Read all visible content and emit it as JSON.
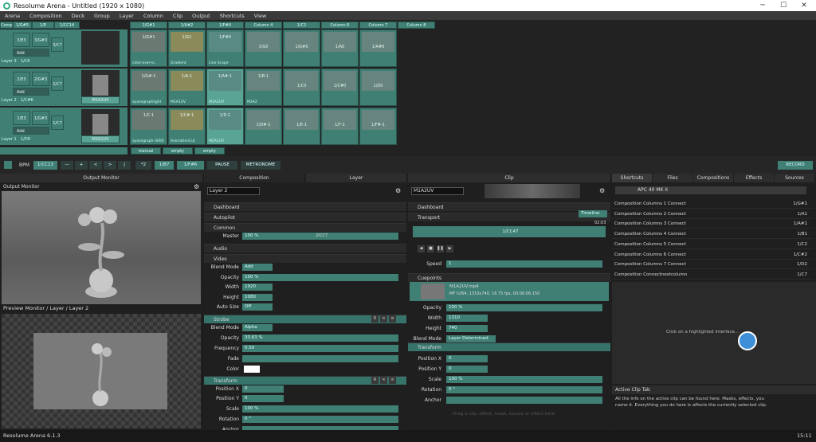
{
  "title": "Resolume Arena - Untitled (1920 x 1080)",
  "menu": [
    "Arena",
    "Composition",
    "Deck",
    "Group",
    "Layer",
    "Column",
    "Clip",
    "Output",
    "Shortcuts",
    "View"
  ],
  "deck": {
    "col_headers": [
      "1/G#1",
      "1/A#2",
      "1/F#0",
      "Column 4",
      "1/C2",
      "Column 6",
      "Column 7",
      "Column 8"
    ],
    "top_tabs": [
      "Comp",
      "1/G#5",
      "1/E",
      "1/CC14"
    ],
    "layers": [
      {
        "name": "Layer 3",
        "key": "1/C6",
        "btns": [
          "3/E3",
          "3/G#3",
          "3/C7"
        ],
        "sub": "Add",
        "clips": [
          {
            "label": "color-over-vi..",
            "key": "1/G#1"
          },
          {
            "label": "Gradient",
            "key": "1/G1"
          },
          {
            "label": "Line Scape",
            "key": "1/F#0"
          },
          {
            "label": "",
            "key": "1/G0"
          },
          {
            "label": "",
            "key": "1/G#0"
          },
          {
            "label": "",
            "key": "1/A0"
          },
          {
            "label": "",
            "key": "1/A#0"
          }
        ],
        "aside": ""
      },
      {
        "name": "Layer 2",
        "key": "1/C#6",
        "btns": [
          "2/E3",
          "2/G#3",
          "2/C7"
        ],
        "sub": "Add",
        "clips": [
          {
            "label": "spacegraphlight",
            "key": "1/G#-1"
          },
          {
            "label": "M1A1UV",
            "key": "1/A-1"
          },
          {
            "label": "M1A2UV",
            "key": "1/A#-1"
          },
          {
            "label": "M3A2",
            "key": "1/B-1"
          },
          {
            "label": "",
            "key": "1/C0"
          },
          {
            "label": "",
            "key": "1/C#0"
          },
          {
            "label": "",
            "key": "1/D0"
          }
        ],
        "aside": "M1A2UV"
      },
      {
        "name": "Layer 1",
        "key": "1/D6",
        "btns": [
          "1/E3",
          "1/G#3",
          "1/C7"
        ],
        "sub": "Add",
        "clips": [
          {
            "label": "spacegraph-3000",
            "key": "1/C-1"
          },
          {
            "label": "AnimationCut",
            "key": "1/C#-1"
          },
          {
            "label": "M2A1UV",
            "key": "1/D-1"
          },
          {
            "label": "",
            "key": "1/D#-1"
          },
          {
            "label": "",
            "key": "1/E-1"
          },
          {
            "label": "",
            "key": "1/F-1"
          },
          {
            "label": "",
            "key": "1/F#-1"
          }
        ],
        "aside": "M2A1UV"
      }
    ],
    "deck_tabs": [
      "manual",
      "empty",
      "empty"
    ]
  },
  "transport": {
    "bpm_label": "BPM",
    "bpm": "1/CC13",
    "keys": [
      "1/B7",
      "1/F#6"
    ],
    "pause": "PAUSE",
    "metronome": "METRONOME",
    "record": "RECORD",
    "small": [
      "|",
      "*2"
    ]
  },
  "output": {
    "tab": "Output Monitor",
    "title": "Output Monitor",
    "preview": "Preview Monitor / Layer / Layer 2"
  },
  "composition": {
    "tabs": [
      "Composition",
      "Layer"
    ],
    "layer_name": "Layer 2",
    "sections": [
      "Dashboard",
      "Autopilot",
      "Common",
      "Audio",
      "Video",
      "Strobe",
      "Transform"
    ],
    "master": "100 %",
    "master_key": "2/CC7",
    "blend": "Add",
    "opacity": "100 %",
    "width": "1920",
    "height": "1080",
    "autosize": "Off",
    "strobe_blend": "Alpha",
    "strobe_opacity": "33.63 %",
    "frequency": "0.50",
    "posx": "0",
    "posy": "0",
    "scale": "100 %",
    "rotation": "0 °",
    "labels": [
      "Master",
      "Blend Mode",
      "Opacity",
      "Width",
      "Height",
      "Auto Size",
      "Blend Mode",
      "Opacity",
      "Frequency",
      "Fade",
      "Color",
      "Position X",
      "Position Y",
      "Scale",
      "Rotation",
      "Anchor"
    ]
  },
  "clip": {
    "tab": "Clip",
    "name": "M1A2UV",
    "transport_mode": "Timeline",
    "time": "02:03",
    "cue_key": "1/CC47",
    "speed": "1",
    "sections": [
      "Dashboard",
      "Transport",
      "Cuepoints",
      "Transform"
    ],
    "file": "M1A2UV.mp4",
    "info": "MF h264, 1310x740, 16.75 fps, 00:00:06.150",
    "opacity": "100 %",
    "width": "1310",
    "height": "740",
    "blend": "Layer Determined",
    "posx": "0",
    "posy": "0",
    "scale": "100 %",
    "rotation": "0 °",
    "labels": [
      "Speed",
      "Opacity",
      "Width",
      "Height",
      "Blend Mode",
      "Position X",
      "Position Y",
      "Scale",
      "Rotation",
      "Anchor"
    ],
    "footer": "Drag a clip, effect, mask, source or effect here"
  },
  "shortcuts": {
    "tabs": [
      "Shortcuts",
      "Files",
      "Compositions",
      "Effects",
      "Sources"
    ],
    "device": "APC 40 MK II",
    "rows": [
      [
        "Composition Columns 1 Connect",
        "1/G#1"
      ],
      [
        "Composition Columns 2 Connect",
        "1/A1"
      ],
      [
        "Composition Columns 3 Connect",
        "1/A#1"
      ],
      [
        "Composition Columns 4 Connect",
        "1/B1"
      ],
      [
        "Composition Columns 5 Connect",
        "1/C2"
      ],
      [
        "Composition Columns 6 Connect",
        "1/C#2"
      ],
      [
        "Composition Columns 7 Connect",
        "1/D2"
      ],
      [
        "Composition Connectnextcolumn",
        "1/C7"
      ]
    ],
    "hint": "Click on a highlighted interface..."
  },
  "help": {
    "title": "Active Clip Tab",
    "text": "All the info on the active clip can be found here. Masks, effects, you name it. Everything you do here is affects the currently selected clip."
  },
  "status": {
    "version": "Resolume Arena 6.1.3",
    "clock": "15:11"
  }
}
